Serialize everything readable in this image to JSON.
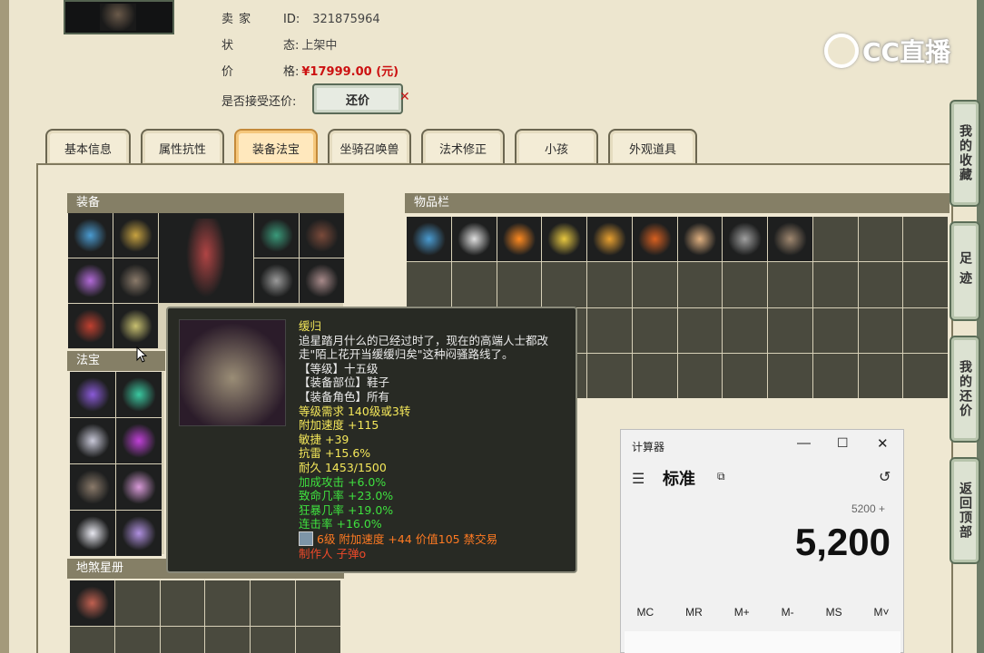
{
  "listing": {
    "seller_label": "卖 家",
    "seller_id_label": "ID:",
    "seller_id": "321875964",
    "status_label": "状",
    "status_label2": "态:",
    "status": "上架中",
    "price_label": "价",
    "price_label2": "格:",
    "price": "¥17999.00 (元)",
    "counter_label": "是否接受还价:",
    "counter_button": "还价"
  },
  "logo": {
    "text": "CC直播"
  },
  "tabs": [
    {
      "label": "基本信息"
    },
    {
      "label": "属性抗性"
    },
    {
      "label": "装备法宝",
      "active": true
    },
    {
      "label": "坐骑召唤兽"
    },
    {
      "label": "法术修正"
    },
    {
      "label": "小孩"
    },
    {
      "label": "外观道具"
    }
  ],
  "panels": {
    "equipment": "装备",
    "treasure": "法宝",
    "star_book": "地煞星册",
    "inventory": "物品栏"
  },
  "right_nav": [
    {
      "label": "我的收藏"
    },
    {
      "label": "足迹"
    },
    {
      "label": "我的还价"
    },
    {
      "label": "返回顶部"
    }
  ],
  "tooltip": {
    "title": "缓归",
    "desc": "追星踏月什么的已经过时了，现在的高端人士都改走\"陌上花开当缓缓归矣\"这种闷骚路线了。",
    "level": "【等级】十五级",
    "slot": "【装备部位】鞋子",
    "role": "【装备角色】所有",
    "req": "等级需求 140级或3转",
    "stat1": "附加速度 +115",
    "stat2": "敏捷 +39",
    "stat3": "抗雷 +15.6%",
    "durability": "耐久 1453/1500",
    "bonus1": "加成攻击 +6.0%",
    "bonus2": "致命几率 +23.0%",
    "bonus3": "狂暴几率 +19.0%",
    "bonus4": "连击率 +16.0%",
    "gem": "6级 附加速度 +44 价值105 禁交易",
    "maker": "制作人 子弹o"
  },
  "calculator": {
    "title": "计算器",
    "mode": "标准",
    "expression": "5200 +",
    "display": "5,200",
    "memory": [
      "MC",
      "MR",
      "M+",
      "M-",
      "MS",
      "M˅"
    ]
  },
  "colors": {
    "price_red": "#cc1111",
    "tooltip_yellow": "#f5e85a",
    "tooltip_green": "#3fe13f",
    "panel_header": "#857f66",
    "active_tab": "#ffe8bd"
  }
}
